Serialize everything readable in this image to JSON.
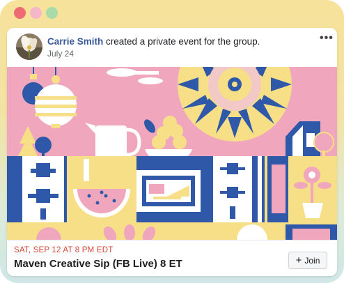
{
  "window": {
    "controls": [
      {
        "name": "close",
        "color": "#ee6b73"
      },
      {
        "name": "minimize",
        "color": "#f4b8c9"
      },
      {
        "name": "maximize",
        "color": "#a8dba8"
      }
    ]
  },
  "post": {
    "author": "Carrie Smith",
    "action": " created a private event for the group.",
    "date": "July 24",
    "more_icon": "more-horizontal-icon"
  },
  "event": {
    "datetime": "SAT, SEP 12 AT 8 PM EDT",
    "title": "Maven Creative Sip (FB Live) 8 ET",
    "join_label": "Join",
    "join_icon": "plus-icon"
  },
  "colors": {
    "pink": "#f0a7bd",
    "blue": "#2f59a8",
    "yellow": "#f6df86",
    "white": "#ffffff",
    "red_text": "#d5473a",
    "link": "#3a5a98"
  }
}
